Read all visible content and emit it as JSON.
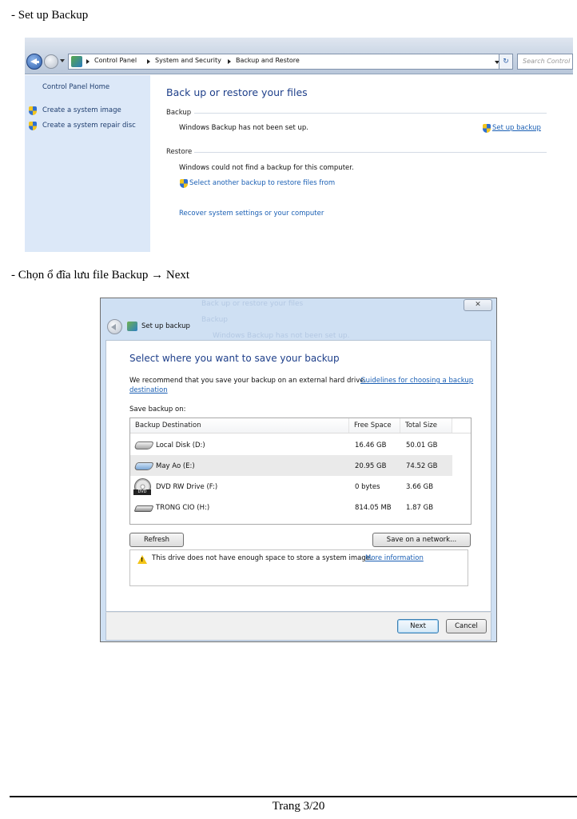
{
  "headings": {
    "step1": "- Set up Backup",
    "step2": "- Chọn ổ đĩa lưu file Backup → Next"
  },
  "backup_restore_window": {
    "address_bar": {
      "breadcrumbs": [
        "Control Panel",
        "System and Security",
        "Backup and Restore"
      ],
      "search_placeholder": "Search Control Panel"
    },
    "sidebar": {
      "home_link": "Control Panel Home",
      "links": [
        "Create a system image",
        "Create a system repair disc"
      ]
    },
    "main": {
      "title": "Back up or restore your files",
      "backup_label": "Backup",
      "backup_status": "Windows Backup has not been set up.",
      "setup_link": "Set up backup",
      "restore_label": "Restore",
      "restore_status": "Windows could not find a backup for this computer.",
      "select_backup_link": "Select another backup to restore files from",
      "recover_link": "Recover system settings or your computer"
    }
  },
  "setup_dialog": {
    "background_ghost": [
      "Back up or restore your files",
      "Backup",
      "Windows Backup has not been set up."
    ],
    "close_label": "✕",
    "title": "Set up backup",
    "heading": "Select where you want to save your backup",
    "recommend_text": "We recommend that you save your backup on an external hard drive.",
    "guidelines_link_1": "Guidelines for choosing a backup",
    "guidelines_link_2": "destination",
    "save_on_label": "Save backup on:",
    "columns": [
      "Backup Destination",
      "Free Space",
      "Total Size"
    ],
    "drives": [
      {
        "name": "Local Disk (D:)",
        "free": "16.46 GB",
        "total": "50.01 GB",
        "icon": "hard-drive-icon"
      },
      {
        "name": "May Ao (E:)",
        "free": "20.95 GB",
        "total": "74.52 GB",
        "icon": "hard-drive-icon"
      },
      {
        "name": "DVD RW Drive (F:)",
        "free": "0 bytes",
        "total": "3.66 GB",
        "icon": "dvd-drive-icon"
      },
      {
        "name": "TRONG CIO (H:)",
        "free": "814.05 MB",
        "total": "1.87 GB",
        "icon": "usb-drive-icon"
      }
    ],
    "dvd_icon_text": "DVD",
    "refresh_button": "Refresh",
    "network_button": "Save on a network...",
    "warning_text": "This drive does not have enough space to store a system image.",
    "more_info_link": "More information",
    "next_button": "Next",
    "cancel_button": "Cancel"
  },
  "footer": {
    "page_label": "Trang 3/20"
  }
}
